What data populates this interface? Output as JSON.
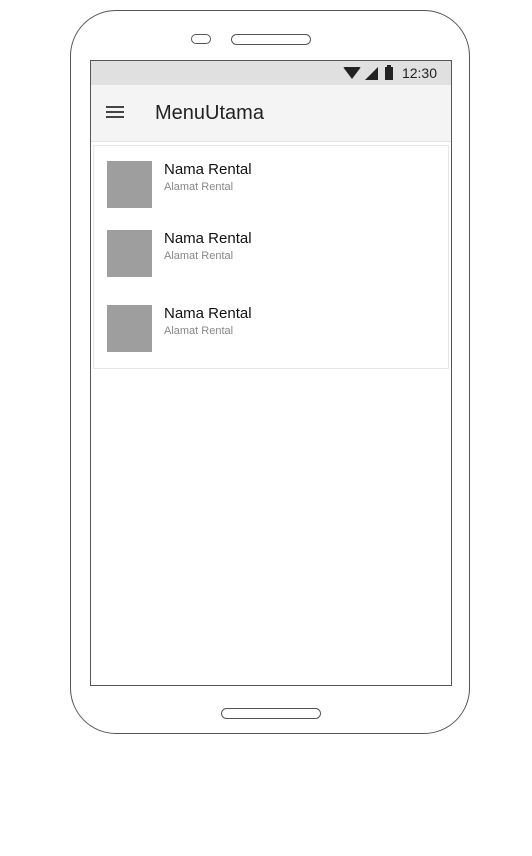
{
  "status_bar": {
    "time": "12:30",
    "icons": [
      "wifi-icon",
      "signal-icon",
      "battery-icon"
    ]
  },
  "app_bar": {
    "menu_icon": "hamburger-menu-icon",
    "title": "MenuUtama"
  },
  "rental_list": {
    "items": [
      {
        "name": "Nama Rental",
        "address": "Alamat Rental"
      },
      {
        "name": "Nama Rental",
        "address": "Alamat Rental"
      },
      {
        "name": "Nama Rental",
        "address": "Alamat Rental"
      }
    ]
  },
  "colors": {
    "status_bar": "#e0e0e0",
    "app_bar": "#f4f4f4",
    "thumbnail": "#9e9e9e",
    "outline": "#555555"
  }
}
